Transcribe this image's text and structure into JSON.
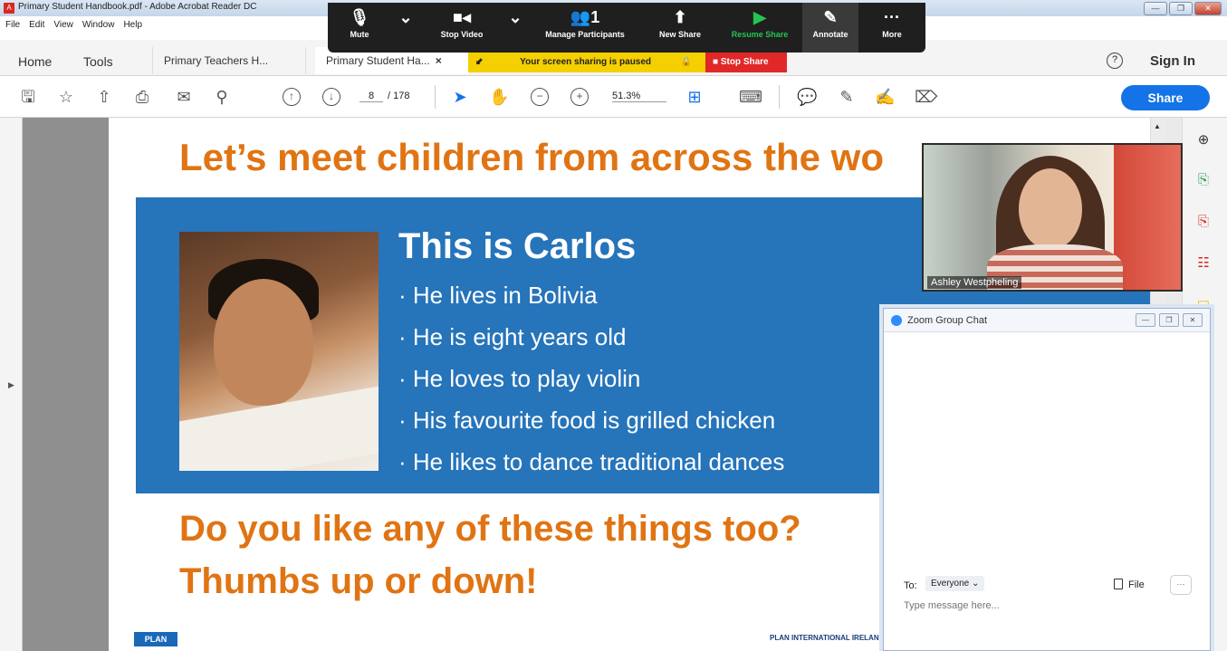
{
  "window": {
    "title": "Primary Student Handbook.pdf - Adobe Acrobat Reader DC",
    "controls": [
      "—",
      "❐",
      "✕"
    ]
  },
  "menu": [
    "File",
    "Edit",
    "View",
    "Window",
    "Help"
  ],
  "tabs": {
    "home": "Home",
    "tools": "Tools",
    "doc1": "Primary Teachers H...",
    "doc2": "Primary Student Ha...",
    "doc2_close": "×"
  },
  "header_right": {
    "help": "?",
    "signin": "Sign In"
  },
  "toolbar": {
    "page_current": "8",
    "page_total": "/ 178",
    "zoom": "51.3%",
    "share": "Share"
  },
  "zoom_bar": {
    "items": [
      {
        "label": "Mute",
        "icon": "microphone-icon",
        "glyph": "🎙"
      },
      {
        "label": "",
        "icon": "chevron-down-icon",
        "glyph": "⌄"
      },
      {
        "label": "Stop Video",
        "icon": "video-camera-icon",
        "glyph": "■◂"
      },
      {
        "label": "",
        "icon": "chevron-down-icon",
        "glyph": "⌄"
      },
      {
        "label": "Manage Participants",
        "icon": "participants-icon",
        "glyph": "👥1"
      },
      {
        "label": "New Share",
        "icon": "new-share-icon",
        "glyph": "⬆"
      },
      {
        "label": "Resume Share",
        "icon": "play-icon",
        "glyph": "▶"
      },
      {
        "label": "Annotate",
        "icon": "pencil-icon",
        "glyph": "✎"
      },
      {
        "label": "More",
        "icon": "more-icon",
        "glyph": "···"
      }
    ],
    "paused_text": "Your screen sharing is paused",
    "stop_share": "Stop Share"
  },
  "slide": {
    "heading": "Let’s meet children from across the wo",
    "title": "This is Carlos",
    "bullets": [
      "· He lives in Bolivia",
      "· He is eight years old",
      "· He loves to play violin",
      "· His favourite food is grilled chicken",
      "· He likes to dance traditional dances"
    ],
    "question1": "Do you like any of these things too?",
    "question2": "Thumbs up or down!",
    "logo": "PLAN",
    "footer": "PLAN INTERNATIONAL IRELAND -"
  },
  "video": {
    "name": "Ashley Westpheling"
  },
  "chat": {
    "title": "Zoom Group Chat",
    "to_label": "To:",
    "to_value": "Everyone ⌄",
    "file_label": "File",
    "more": "···",
    "placeholder": "Type message here..."
  },
  "colors": {
    "accent_orange": "#e07413",
    "slide_blue": "#2674ba",
    "share_blue": "#1473e6",
    "zoom_green": "#23c552",
    "paused_yellow": "#f5d000",
    "stop_red": "#e02828"
  }
}
